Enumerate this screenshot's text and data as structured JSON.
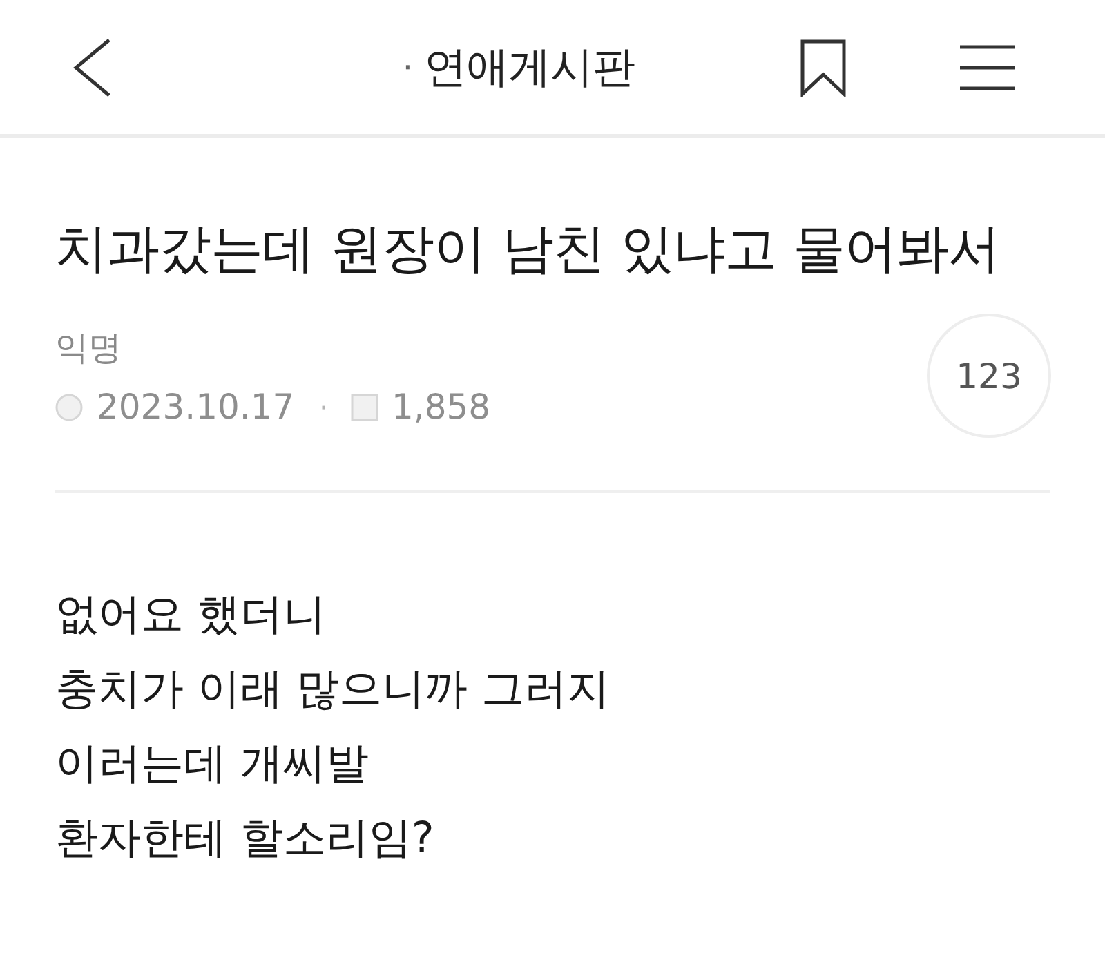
{
  "header": {
    "board_dot": "·",
    "board_name": "연애게시판"
  },
  "post": {
    "title": "치과갔는데 원장이 남친 있냐고 물어봐서",
    "author": "익명",
    "date": "2023.10.17",
    "meta_separator": "·",
    "views": "1,858",
    "comment_count": "123",
    "body_lines": [
      "없어요 했더니",
      "충치가 이래 많으니까 그러지",
      "이러는데 개씨발",
      "환자한테 할소리임?"
    ]
  }
}
